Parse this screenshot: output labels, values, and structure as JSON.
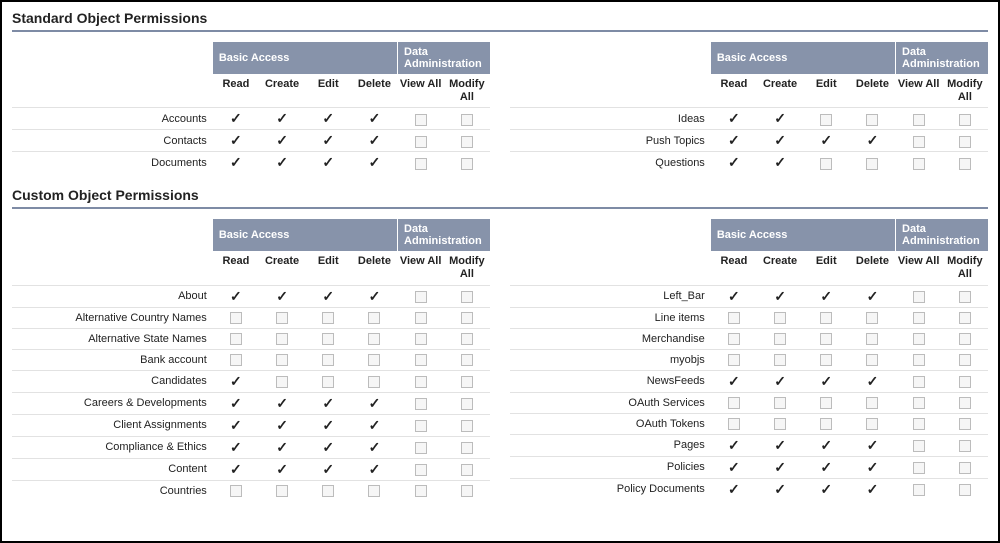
{
  "sections": {
    "standard": {
      "title": "Standard Object Permissions",
      "headers": {
        "group_basic": "Basic Access",
        "group_admin": "Data Administration",
        "cols": [
          "Read",
          "Create",
          "Edit",
          "Delete",
          "View All",
          "Modify All"
        ]
      },
      "left_rows": [
        {
          "label": "Accounts",
          "perms": [
            true,
            true,
            true,
            true,
            false,
            false
          ]
        },
        {
          "label": "Contacts",
          "perms": [
            true,
            true,
            true,
            true,
            false,
            false
          ]
        },
        {
          "label": "Documents",
          "perms": [
            true,
            true,
            true,
            true,
            false,
            false
          ]
        }
      ],
      "right_rows": [
        {
          "label": "Ideas",
          "perms": [
            true,
            true,
            false,
            false,
            false,
            false
          ]
        },
        {
          "label": "Push Topics",
          "perms": [
            true,
            true,
            true,
            true,
            false,
            false
          ]
        },
        {
          "label": "Questions",
          "perms": [
            true,
            true,
            false,
            false,
            false,
            false
          ]
        }
      ]
    },
    "custom": {
      "title": "Custom Object Permissions",
      "headers": {
        "group_basic": "Basic Access",
        "group_admin": "Data Administration",
        "cols": [
          "Read",
          "Create",
          "Edit",
          "Delete",
          "View All",
          "Modify All"
        ]
      },
      "left_rows": [
        {
          "label": "About",
          "perms": [
            true,
            true,
            true,
            true,
            false,
            false
          ]
        },
        {
          "label": "Alternative Country Names",
          "perms": [
            false,
            false,
            false,
            false,
            false,
            false
          ]
        },
        {
          "label": "Alternative State Names",
          "perms": [
            false,
            false,
            false,
            false,
            false,
            false
          ]
        },
        {
          "label": "Bank account",
          "perms": [
            false,
            false,
            false,
            false,
            false,
            false
          ]
        },
        {
          "label": "Candidates",
          "perms": [
            true,
            false,
            false,
            false,
            false,
            false
          ]
        },
        {
          "label": "Careers & Developments",
          "perms": [
            true,
            true,
            true,
            true,
            false,
            false
          ]
        },
        {
          "label": "Client Assignments",
          "perms": [
            true,
            true,
            true,
            true,
            false,
            false
          ]
        },
        {
          "label": "Compliance & Ethics",
          "perms": [
            true,
            true,
            true,
            true,
            false,
            false
          ]
        },
        {
          "label": "Content",
          "perms": [
            true,
            true,
            true,
            true,
            false,
            false
          ]
        },
        {
          "label": "Countries",
          "perms": [
            false,
            false,
            false,
            false,
            false,
            false
          ]
        }
      ],
      "right_rows": [
        {
          "label": "Left_Bar",
          "perms": [
            true,
            true,
            true,
            true,
            false,
            false
          ]
        },
        {
          "label": "Line items",
          "perms": [
            false,
            false,
            false,
            false,
            false,
            false
          ]
        },
        {
          "label": "Merchandise",
          "perms": [
            false,
            false,
            false,
            false,
            false,
            false
          ]
        },
        {
          "label": "myobjs",
          "perms": [
            false,
            false,
            false,
            false,
            false,
            false
          ]
        },
        {
          "label": "NewsFeeds",
          "perms": [
            true,
            true,
            true,
            true,
            false,
            false
          ]
        },
        {
          "label": "OAuth Services",
          "perms": [
            false,
            false,
            false,
            false,
            false,
            false
          ]
        },
        {
          "label": "OAuth Tokens",
          "perms": [
            false,
            false,
            false,
            false,
            false,
            false
          ]
        },
        {
          "label": "Pages",
          "perms": [
            true,
            true,
            true,
            true,
            false,
            false
          ]
        },
        {
          "label": "Policies",
          "perms": [
            true,
            true,
            true,
            true,
            false,
            false
          ]
        },
        {
          "label": "Policy Documents",
          "perms": [
            true,
            true,
            true,
            true,
            false,
            false
          ]
        }
      ]
    }
  }
}
